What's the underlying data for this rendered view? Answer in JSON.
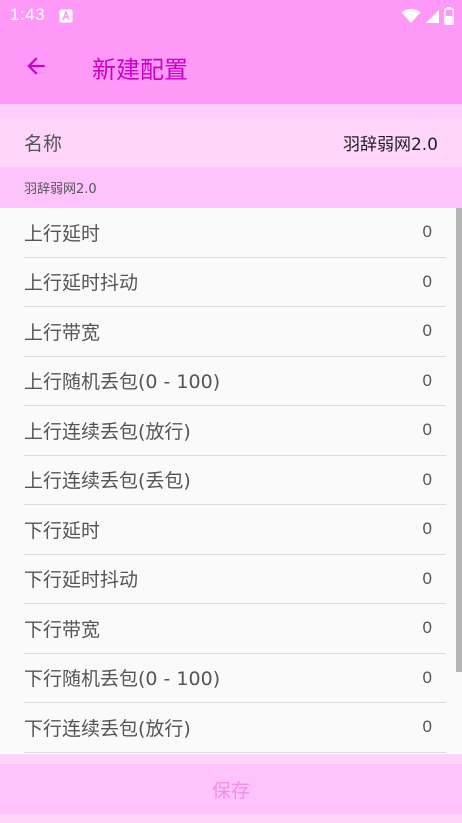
{
  "status_bar": {
    "time": "1:43",
    "notification_icon": "a-box-icon",
    "wifi_icon": "wifi-icon",
    "signal_icon": "signal-icon",
    "battery_icon": "battery-icon"
  },
  "app_bar": {
    "back_icon": "arrow-left-icon",
    "title": "新建配置"
  },
  "name_field": {
    "label": "名称",
    "value": "羽辞弱网2.0"
  },
  "summary": {
    "text": "羽辞弱网2.0"
  },
  "settings": [
    {
      "label": "上行延时",
      "value": "0"
    },
    {
      "label": "上行延时抖动",
      "value": "0"
    },
    {
      "label": "上行带宽",
      "value": "0"
    },
    {
      "label": "上行随机丢包(0 - 100)",
      "value": "0"
    },
    {
      "label": "上行连续丢包(放行)",
      "value": "0"
    },
    {
      "label": "上行连续丢包(丢包)",
      "value": "0"
    },
    {
      "label": "下行延时",
      "value": "0"
    },
    {
      "label": "下行延时抖动",
      "value": "0"
    },
    {
      "label": "下行带宽",
      "value": "0"
    },
    {
      "label": "下行随机丢包(0 - 100)",
      "value": "0"
    },
    {
      "label": "下行连续丢包(放行)",
      "value": "0"
    }
  ],
  "save_button": {
    "label": "保存"
  },
  "colors": {
    "app_bar_bg": "#ff99f8",
    "title": "#cc00c8",
    "name_row_bg": "#ffd5fb",
    "summary_bg": "#ffc3fb",
    "save_text": "#f08ee9"
  }
}
